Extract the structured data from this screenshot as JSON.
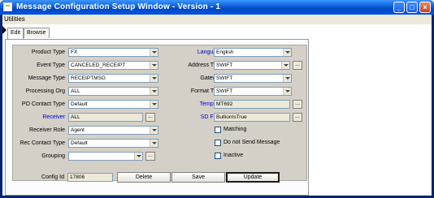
{
  "window": {
    "title": "Message Configuration Setup Window - Version - 1"
  },
  "menu": {
    "utilities": "Utilities"
  },
  "tabs": [
    "Edit",
    "Browse"
  ],
  "left_fields": [
    {
      "label": "Product Type",
      "value": "FX",
      "type": "dropdown",
      "link": false
    },
    {
      "label": "Event Type",
      "value": "CANCELED_RECEIPT",
      "type": "dropdown",
      "link": false
    },
    {
      "label": "Message Type",
      "value": "RECEIPTMSG",
      "type": "dropdown",
      "link": false
    },
    {
      "label": "Processing Org",
      "value": "ALL",
      "type": "dropdown",
      "link": false
    },
    {
      "label": "PO Contact Type",
      "value": "Default",
      "type": "dropdown",
      "link": false
    },
    {
      "label": "Receiver",
      "value": "ALL",
      "type": "readonly-ellipsis",
      "link": true
    },
    {
      "label": "Receiver Role",
      "value": "Agent",
      "type": "dropdown",
      "link": false
    },
    {
      "label": "Rec Contact Type",
      "value": "Default",
      "type": "dropdown",
      "link": false
    },
    {
      "label": "Grouping",
      "value": "",
      "type": "dropdown-ellipsis",
      "link": false
    }
  ],
  "right_fields": [
    {
      "label": "Language",
      "value": "English",
      "type": "dropdown",
      "link": true
    },
    {
      "label": "Address Type",
      "value": "SWIFT",
      "type": "dropdown-ellipsis",
      "link": false
    },
    {
      "label": "Gateway",
      "value": "SWIFT",
      "type": "dropdown",
      "link": false
    },
    {
      "label": "Format Type",
      "value": "SWIFT",
      "type": "dropdown",
      "link": false
    },
    {
      "label": "Template",
      "value": "MT692",
      "type": "readonly-ellipsis",
      "link": true
    },
    {
      "label": "SD Filter",
      "value": "BullionIsTrue",
      "type": "readonly-ellipsis",
      "link": true
    }
  ],
  "checkboxes": [
    {
      "label": "Matching",
      "checked": false
    },
    {
      "label": "Do not Send Message",
      "checked": false
    },
    {
      "label": "Inactive",
      "checked": false
    }
  ],
  "footer": {
    "config_id_label": "Config Id",
    "config_id_value": "17806",
    "delete": "Delete",
    "save": "Save",
    "update": "Update"
  },
  "ellipsis": "..."
}
